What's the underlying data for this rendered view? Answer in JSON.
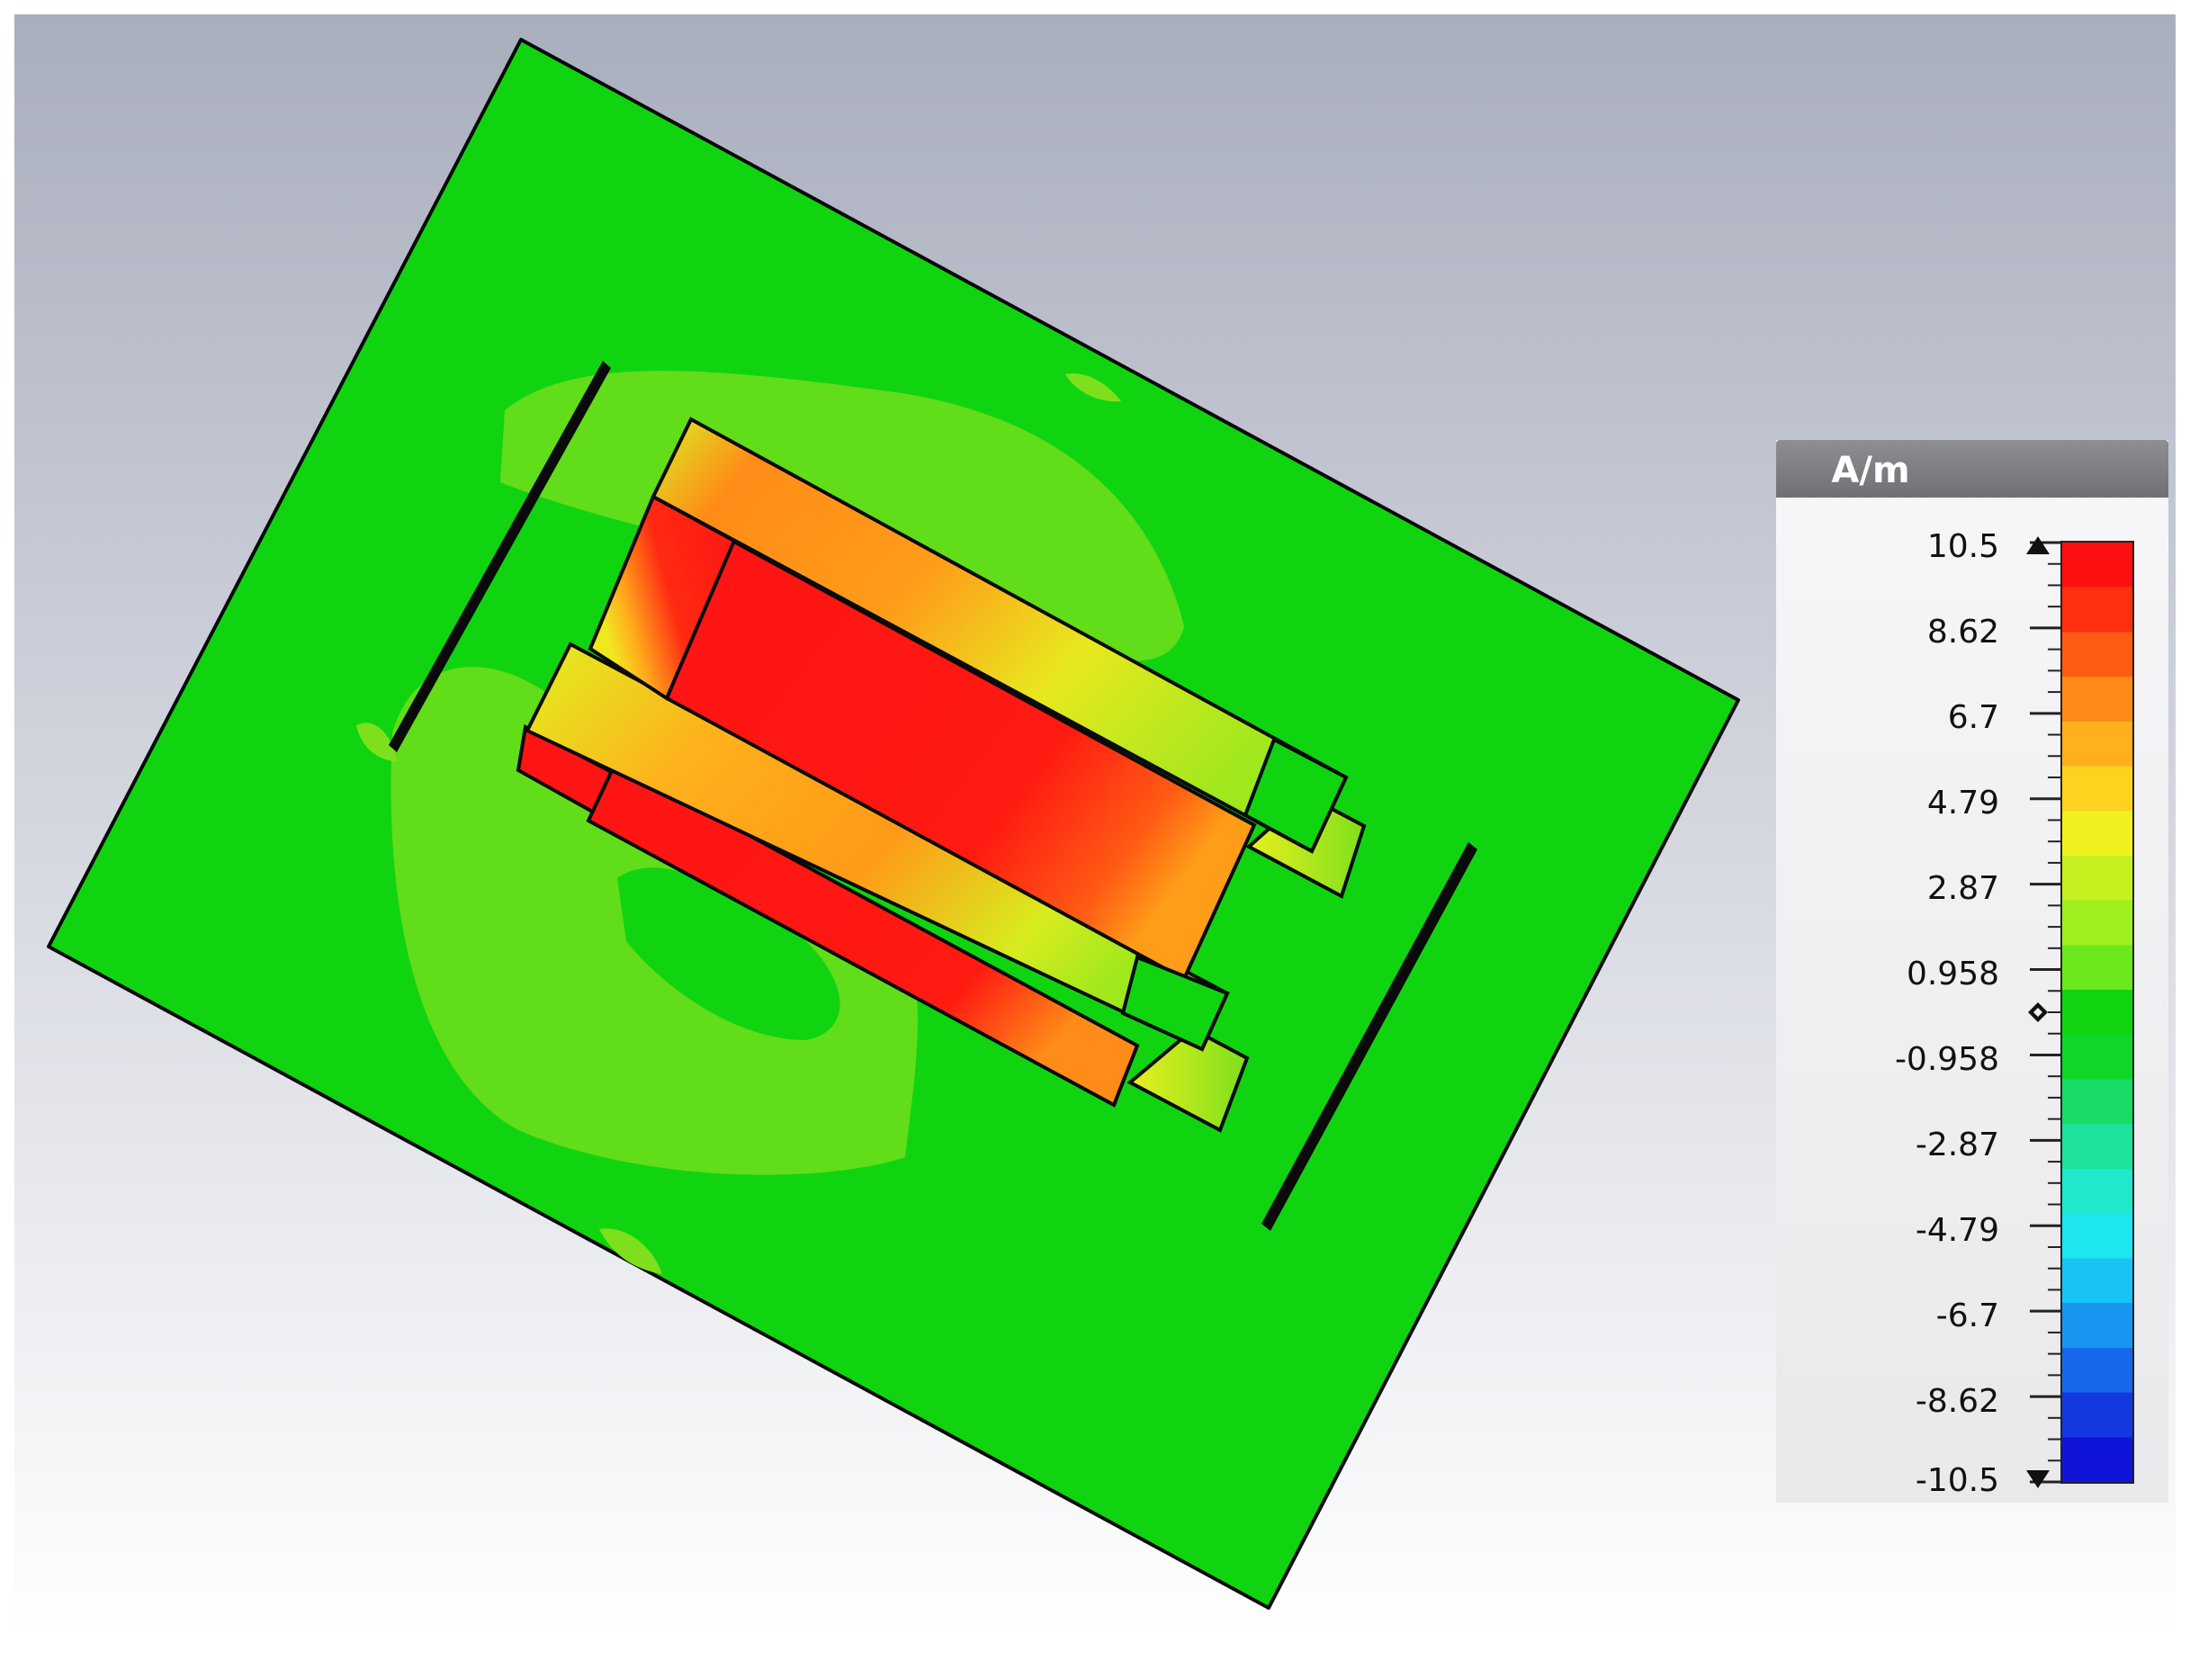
{
  "legend": {
    "unit": "A/m",
    "ticks": [
      "10.5",
      "8.62",
      "6.7",
      "4.79",
      "2.87",
      "0.958",
      "-0.958",
      "-2.87",
      "-4.79",
      "-6.7",
      "-8.62",
      "-10.5"
    ],
    "range": [
      -10.5,
      10.5
    ],
    "current_marker_value": 0,
    "colormap": [
      "#ff1010",
      "#ff3010",
      "#ff5b12",
      "#ff8a18",
      "#ffb01c",
      "#ffd21f",
      "#f0f01f",
      "#c6f01f",
      "#9ef01f",
      "#6ce81c",
      "#11d411",
      "#10d62a",
      "#18dc66",
      "#1ce29c",
      "#1fe8cc",
      "#1ee6f0",
      "#18c4f6",
      "#1896f2",
      "#1868ec",
      "#1438e0",
      "#0f14d8"
    ]
  },
  "colors": {
    "background_top": "#a9aebd",
    "background_bottom": "#ffffff",
    "plate": "#11d411",
    "high_field": "#ff1414",
    "medium_field": "#ff8c1c",
    "low_field": "#9ee81c"
  }
}
